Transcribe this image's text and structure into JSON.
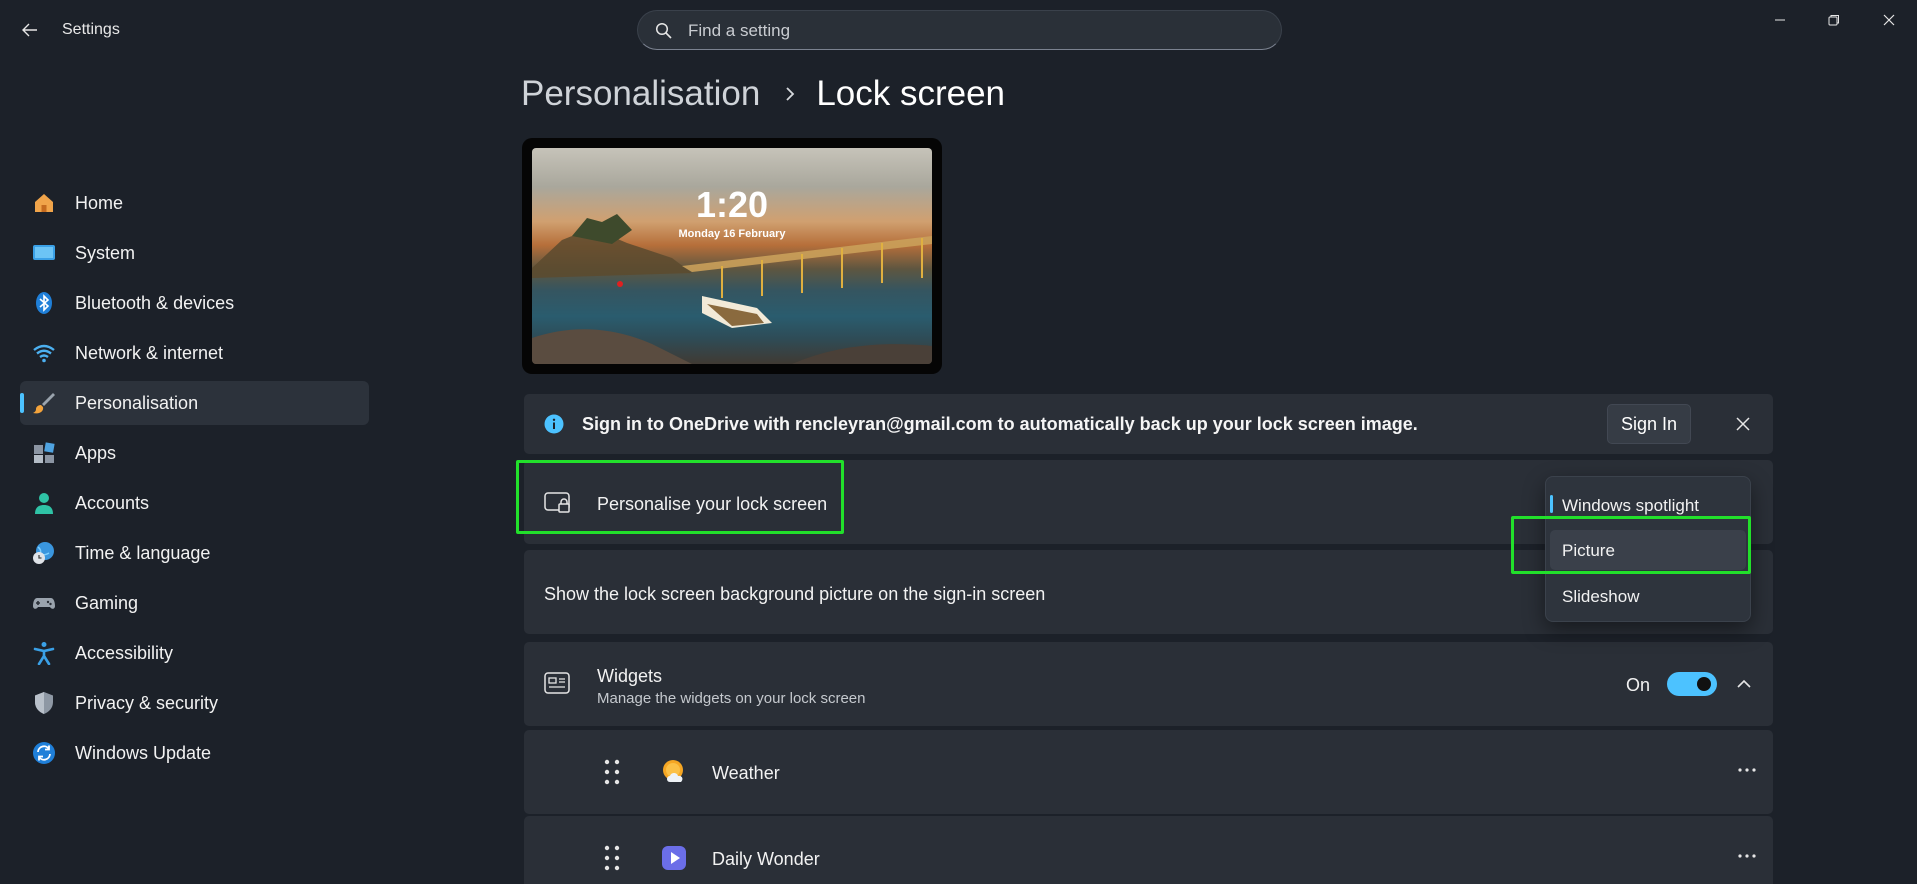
{
  "app": {
    "title": "Settings"
  },
  "search": {
    "placeholder": "Find a setting"
  },
  "sidebar": {
    "items": [
      {
        "label": "Home",
        "icon": "home-icon"
      },
      {
        "label": "System",
        "icon": "system-icon"
      },
      {
        "label": "Bluetooth & devices",
        "icon": "bluetooth-icon"
      },
      {
        "label": "Network & internet",
        "icon": "wifi-icon"
      },
      {
        "label": "Personalisation",
        "icon": "brush-icon",
        "active": true
      },
      {
        "label": "Apps",
        "icon": "apps-icon"
      },
      {
        "label": "Accounts",
        "icon": "account-icon"
      },
      {
        "label": "Time & language",
        "icon": "globe-clock-icon"
      },
      {
        "label": "Gaming",
        "icon": "gamepad-icon"
      },
      {
        "label": "Accessibility",
        "icon": "accessibility-icon"
      },
      {
        "label": "Privacy & security",
        "icon": "shield-icon"
      },
      {
        "label": "Windows Update",
        "icon": "update-icon"
      }
    ]
  },
  "breadcrumb": {
    "parent": "Personalisation",
    "current": "Lock screen"
  },
  "preview": {
    "time": "1:20",
    "date": "Monday 16 February"
  },
  "banner": {
    "message": "Sign in to OneDrive with rencleyran@gmail.com to automatically back up your lock screen image.",
    "button": "Sign In"
  },
  "lock_row": {
    "label": "Personalise your lock screen"
  },
  "signin_row": {
    "label": "Show the lock screen background picture on the sign-in screen"
  },
  "widgets": {
    "label": "Widgets",
    "description": "Manage the widgets on your lock screen",
    "state": "On",
    "toggle_on": true,
    "items": [
      {
        "label": "Weather",
        "icon": "weather-icon"
      },
      {
        "label": "Daily Wonder",
        "icon": "play-icon"
      }
    ]
  },
  "dropdown": {
    "options": [
      "Windows spotlight",
      "Picture",
      "Slideshow"
    ],
    "selected": "Windows spotlight",
    "hovered": "Picture"
  },
  "colors": {
    "accent": "#4cc2ff",
    "highlight": "#22e02b",
    "background": "#1c2129",
    "card": "#2a2f37"
  }
}
